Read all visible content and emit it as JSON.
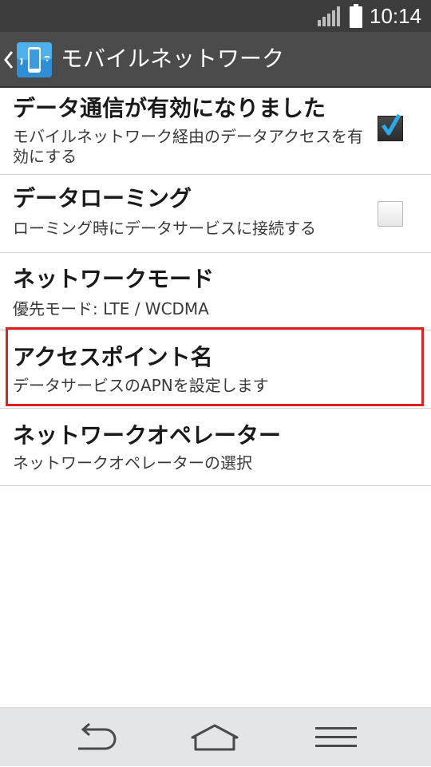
{
  "status_bar": {
    "time": "10:14",
    "icons": [
      "signal-icon",
      "battery-icon"
    ]
  },
  "action_bar": {
    "title": "モバイルネットワーク",
    "icons": [
      "back-chevron-icon",
      "mobile-network-app-icon"
    ]
  },
  "items": [
    {
      "title": "データ通信が有効になりました",
      "summary": "モバイルネットワーク経由のデータアクセスを有効にする",
      "checkbox": true
    },
    {
      "title": "データローミング",
      "summary": "ローミング時にデータサービスに接続する",
      "checkbox": false
    },
    {
      "title": "ネットワークモード",
      "summary": "優先モード: LTE / WCDMA"
    },
    {
      "title": "アクセスポイント名",
      "summary": "データサービスのAPNを設定します",
      "highlighted": true
    },
    {
      "title": "ネットワークオペレーター",
      "summary": "ネットワークオペレーターの選択"
    }
  ],
  "nav_bar": {
    "icons": [
      "back-icon",
      "home-icon",
      "menu-icon"
    ]
  },
  "colors": {
    "status_bar": "#3c3c3c",
    "action_bar": "#4b4b4b",
    "highlight": "#e02020",
    "check_accent": "#2aa9e8",
    "nav_bar": "#e3e5e7"
  }
}
